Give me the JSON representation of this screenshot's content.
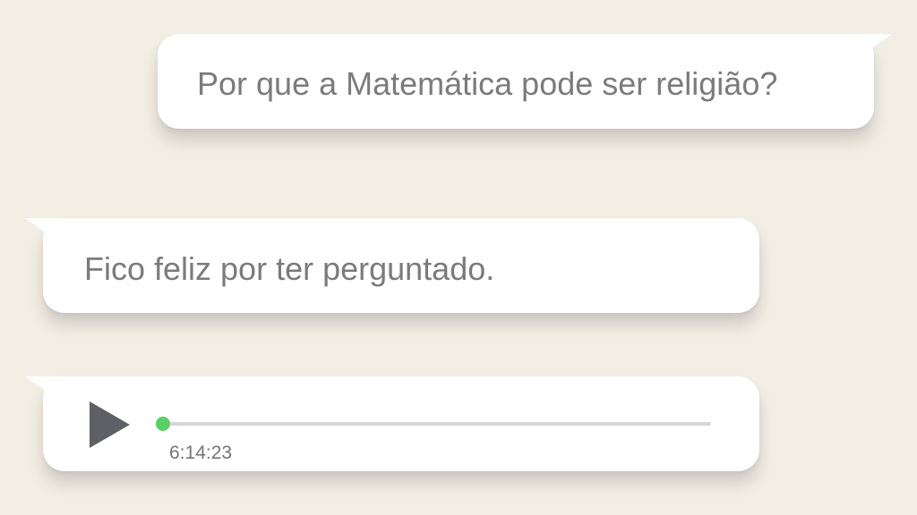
{
  "chat": {
    "outgoing": {
      "text": "Por que a Matemática pode ser religião?"
    },
    "incoming": {
      "text": "Fico feliz por ter perguntado."
    },
    "voice_message": {
      "duration": "6:14:23",
      "progress": 0,
      "accent_color": "#57d163",
      "play_icon": "play-icon"
    }
  }
}
